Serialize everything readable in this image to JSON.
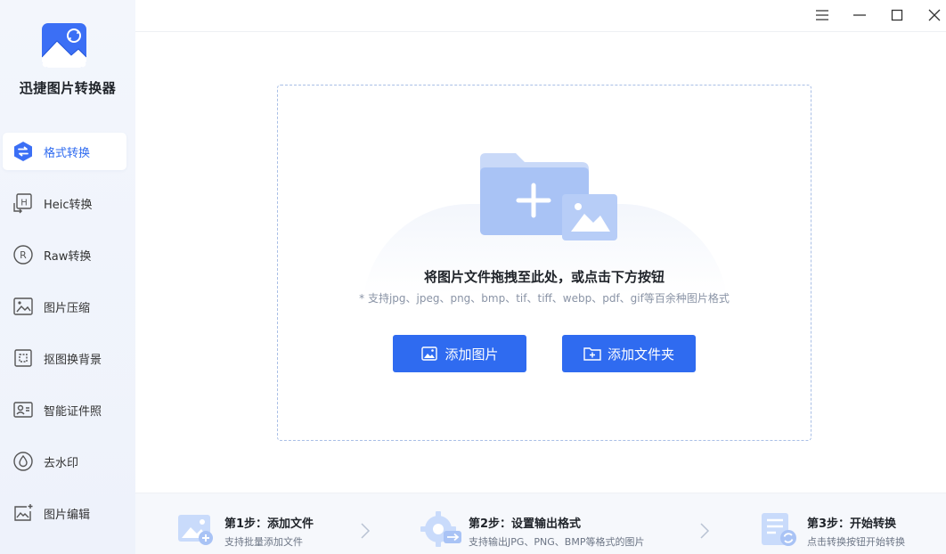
{
  "app": {
    "name": "迅捷图片转换器"
  },
  "sidebar": {
    "items": [
      {
        "label": "格式转换",
        "icon": "format-convert-icon",
        "active": true
      },
      {
        "label": "Heic转换",
        "icon": "heic-icon",
        "active": false
      },
      {
        "label": "Raw转换",
        "icon": "raw-icon",
        "active": false
      },
      {
        "label": "图片压缩",
        "icon": "image-compress-icon",
        "active": false
      },
      {
        "label": "抠图换背景",
        "icon": "cutout-icon",
        "active": false
      },
      {
        "label": "智能证件照",
        "icon": "id-photo-icon",
        "active": false
      },
      {
        "label": "去水印",
        "icon": "watermark-icon",
        "active": false
      },
      {
        "label": "图片编辑",
        "icon": "image-edit-icon",
        "active": false
      }
    ]
  },
  "dropzone": {
    "title": "将图片文件拖拽至此处，或点击下方按钮",
    "subtitle": "* 支持jpg、jpeg、png、bmp、tif、tiff、webp、pdf、gif等百余种图片格式",
    "add_image_label": "添加图片",
    "add_folder_label": "添加文件夹"
  },
  "steps": [
    {
      "title": "第1步：添加文件",
      "desc": "支持批量添加文件"
    },
    {
      "title": "第2步：设置输出格式",
      "desc": "支持输出JPG、PNG、BMP等格式的图片"
    },
    {
      "title": "第3步：开始转换",
      "desc": "点击转换按钮开始转换"
    }
  ],
  "colors": {
    "accent": "#2f6bf0",
    "sidebar_bg": "#f3f6fc"
  }
}
